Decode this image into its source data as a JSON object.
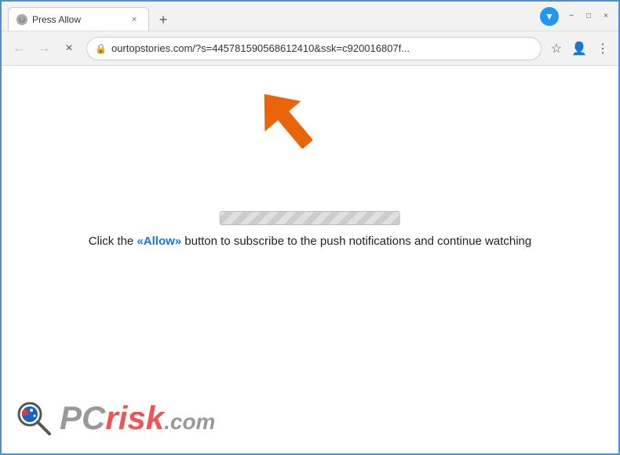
{
  "window": {
    "title": "Press Allow",
    "tab": {
      "title": "Press Allow",
      "close_label": "×"
    },
    "new_tab_label": "+",
    "controls": {
      "minimize": "−",
      "maximize": "□",
      "close": "×"
    }
  },
  "toolbar": {
    "back_label": "←",
    "forward_label": "→",
    "stop_label": "×",
    "address": "ourtopstories.com/?s=445781590568612410&ssk=c920016807f...",
    "lock_icon": "🔒",
    "star_icon": "☆",
    "profile_icon": "👤",
    "menu_icon": "⋮",
    "download_icon": "▼"
  },
  "page": {
    "message_prefix": "Click the ",
    "message_allow": "«Allow»",
    "message_suffix": " button to subscribe to the push notifications and continue watching",
    "progress_bar_label": "loading-progress-bar"
  },
  "logo": {
    "pc_text": "PC",
    "risk_text": "risk",
    "com_text": ".com"
  },
  "colors": {
    "border": "#4a90d9",
    "arrow_orange": "#e8650a",
    "allow_blue": "#1a73e8",
    "logo_gray": "#888888",
    "logo_red": "#ee5555"
  }
}
